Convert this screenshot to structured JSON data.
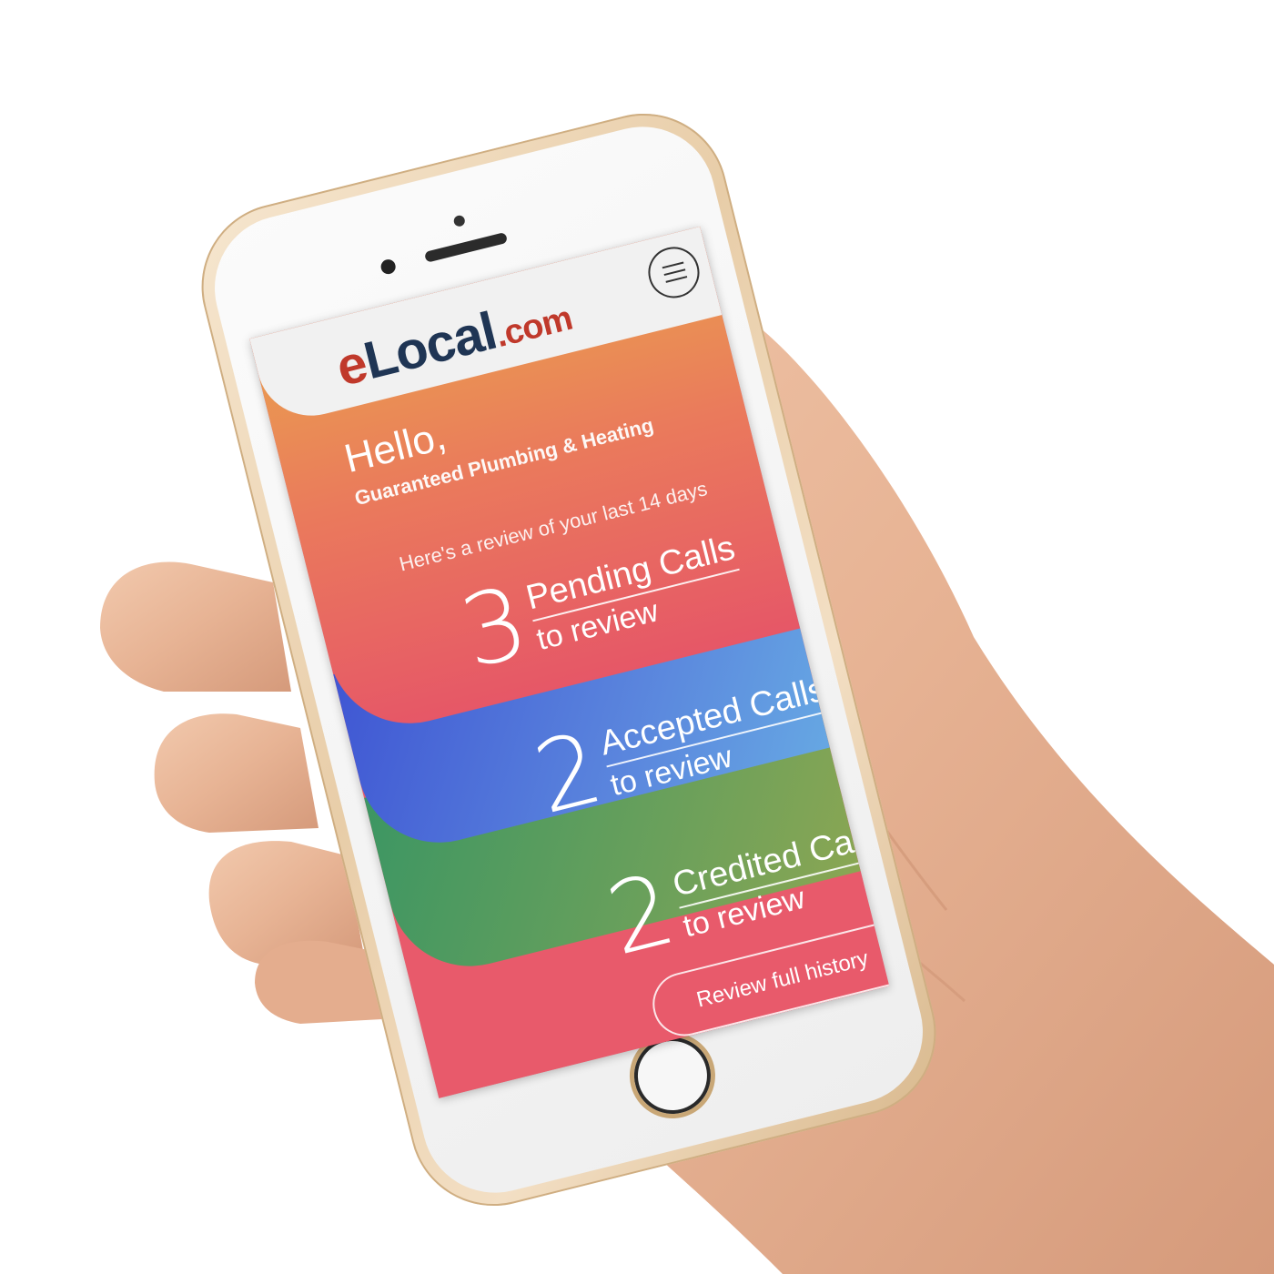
{
  "brand": {
    "logo_e": "e",
    "logo_local": "Local",
    "logo_com": ".com"
  },
  "greeting": {
    "hello": "Hello,",
    "business_name": "Guaranteed Plumbing & Heating",
    "intro": "Here's a review of your last 14 days"
  },
  "stats": [
    {
      "count": "3",
      "title": "Pending Calls",
      "subtitle": "to review"
    },
    {
      "count": "2",
      "title": "Accepted Calls",
      "subtitle": "to review"
    },
    {
      "count": "2",
      "title": "Credited Calls",
      "subtitle": "to review"
    }
  ],
  "actions": {
    "history_label": "Review full history"
  },
  "colors": {
    "brand_red": "#c0392b",
    "brand_navy": "#1f3554",
    "orange_gradient": "#e9a04e",
    "blue_band": "#4a6fd8",
    "green_band": "#5a9a5e",
    "pink_band": "#e85a6b"
  }
}
